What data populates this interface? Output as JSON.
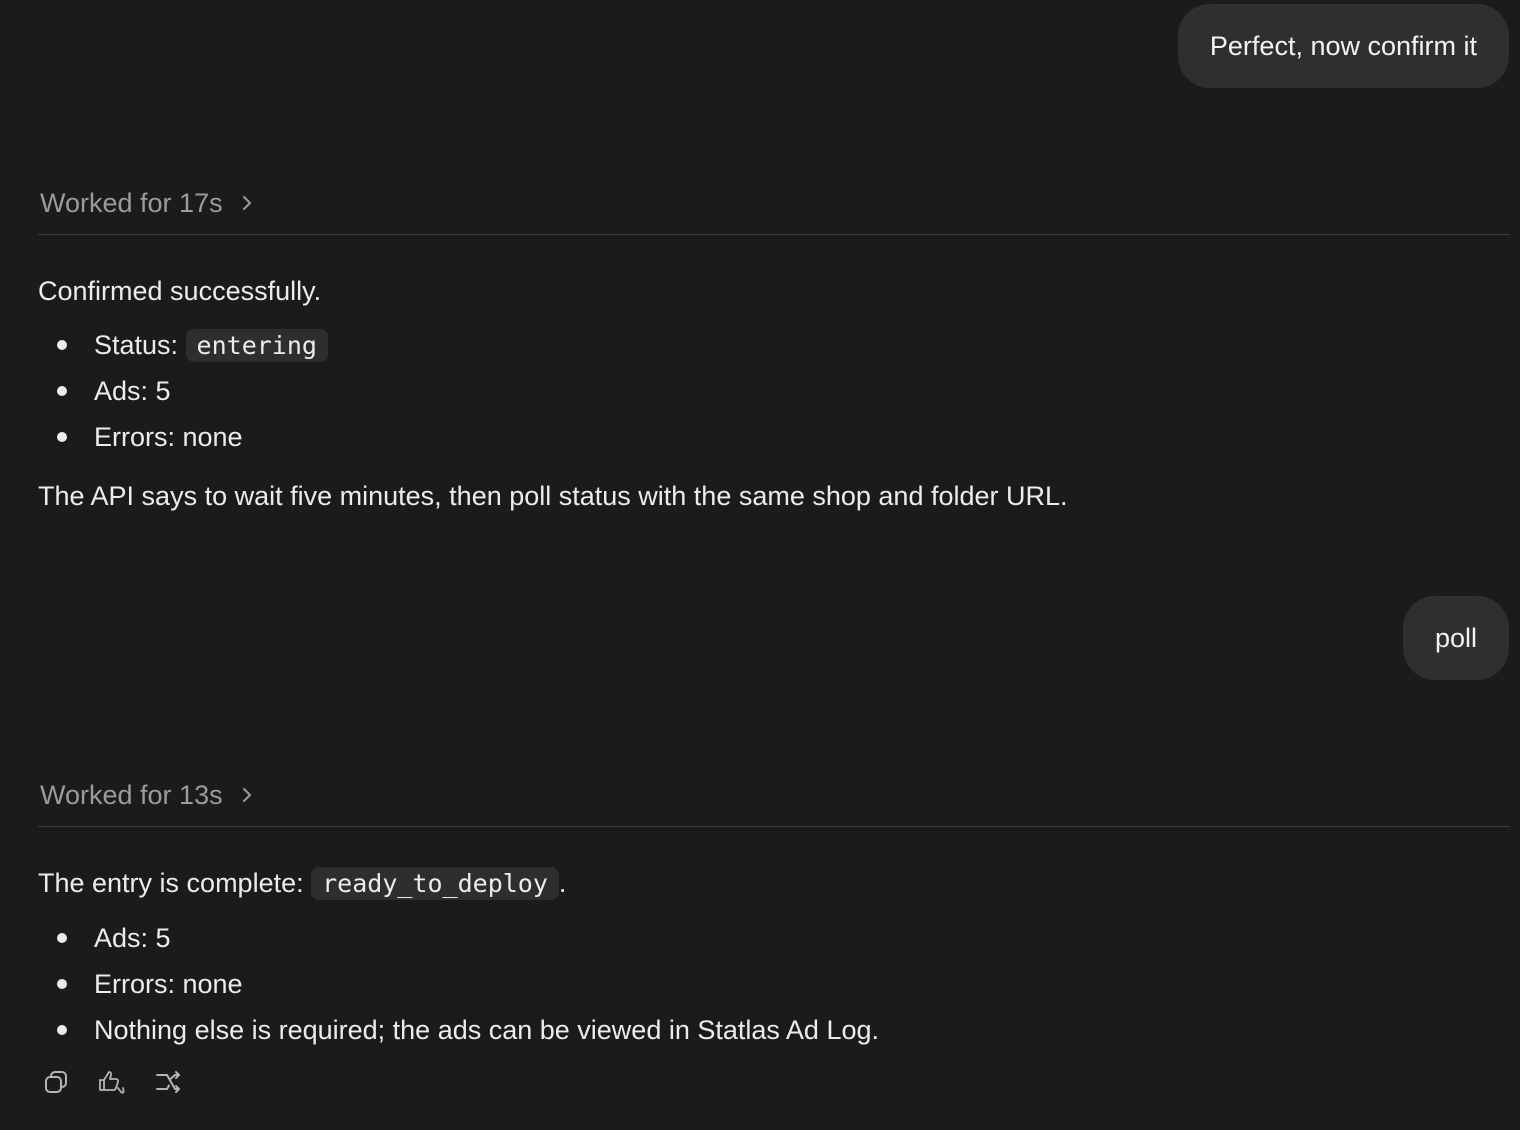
{
  "messages": {
    "user_1": "Perfect, now confirm it",
    "user_2": "poll"
  },
  "turn_1": {
    "worked_label": "Worked for 17s",
    "intro": "Confirmed successfully.",
    "status_label": "Status: ",
    "status_value": "entering",
    "bullet_ads": "Ads: 5",
    "bullet_errors": "Errors: none",
    "note": "The API says to wait five minutes, then poll status with the same shop and folder URL."
  },
  "turn_2": {
    "worked_label": "Worked for 13s",
    "intro_prefix": "The entry is complete: ",
    "intro_code": "ready_to_deploy",
    "intro_suffix": ".",
    "bullet_ads": "Ads: 5",
    "bullet_errors": "Errors: none",
    "bullet_note": "Nothing else is required; the ads can be viewed in Statlas Ad Log."
  },
  "actions": {
    "icons": [
      "copy-icon",
      "thumbs-icon",
      "share-icon"
    ]
  },
  "colors": {
    "background": "#1b1b1b",
    "bubble": "#2f2f2f",
    "muted_text": "#9b9b9b",
    "text": "#ececec",
    "code_bg": "#2e2e2e"
  }
}
